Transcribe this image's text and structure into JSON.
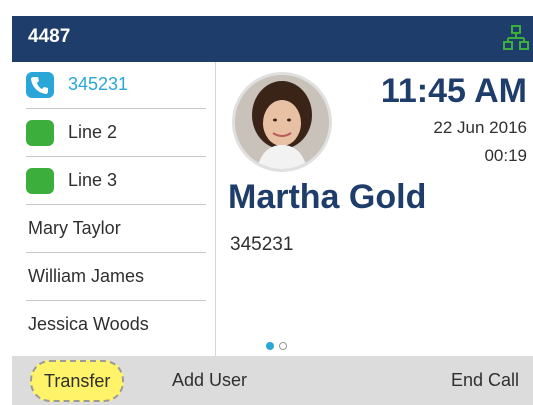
{
  "status_bar": {
    "extension": "4487",
    "network_icon": "network-icon"
  },
  "lines": [
    {
      "label": "345231",
      "icon": "phone-icon",
      "active": true
    },
    {
      "label": "Line 2",
      "icon": "line-key-icon",
      "active": false
    },
    {
      "label": "Line 3",
      "icon": "line-key-icon",
      "active": false
    }
  ],
  "contacts": [
    {
      "label": "Mary Taylor"
    },
    {
      "label": "William James"
    },
    {
      "label": "Jessica Woods"
    }
  ],
  "call": {
    "time": "11:45 AM",
    "date": "22 Jun 2016",
    "duration": "00:19",
    "caller_name": "Martha Gold",
    "caller_number": "345231",
    "page_indicator": {
      "current": 1,
      "total": 2
    }
  },
  "softkeys": {
    "transfer": "Transfer",
    "add_user": "Add User",
    "end_call": "End Call"
  },
  "colors": {
    "header": "#1e3d6b",
    "accent": "#2aa6d8",
    "line_key": "#3cae3c",
    "highlight": "#fff36a",
    "softkey_bar": "#dcdcdc"
  }
}
